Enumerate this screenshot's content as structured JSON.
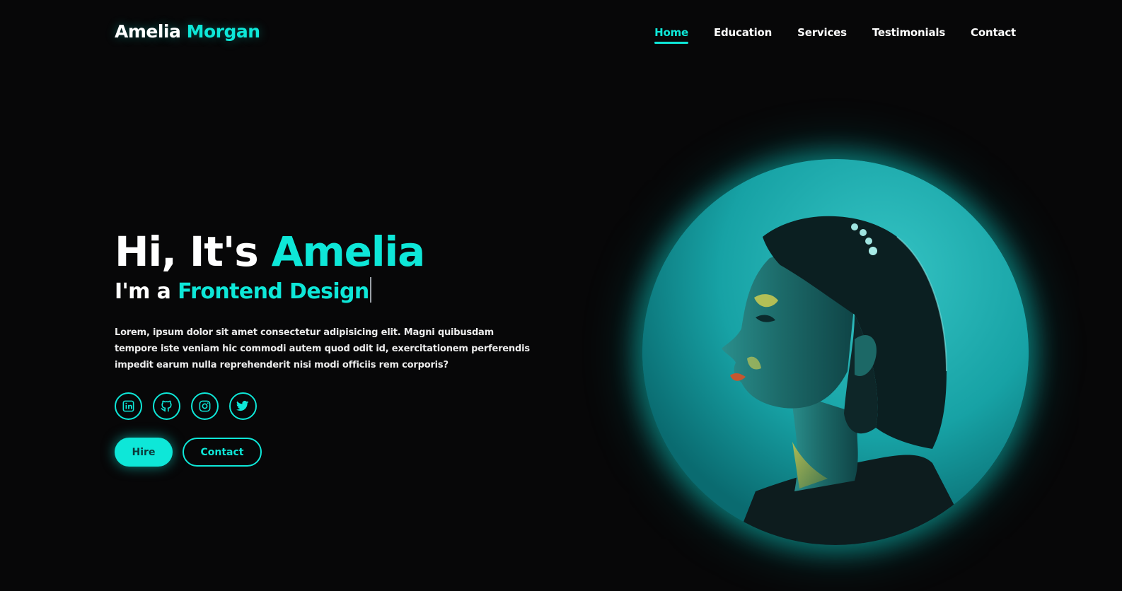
{
  "brand": {
    "first": "Amelia",
    "last": "Morgan"
  },
  "nav": {
    "items": [
      {
        "label": "Home",
        "active": true
      },
      {
        "label": "Education",
        "active": false
      },
      {
        "label": "Services",
        "active": false
      },
      {
        "label": "Testimonials",
        "active": false
      },
      {
        "label": "Contact",
        "active": false
      }
    ]
  },
  "hero": {
    "greeting": "Hi, It's",
    "name": "Amelia",
    "role_prefix": "I'm a",
    "role": "Frontend Design",
    "description": "Lorem, ipsum dolor sit amet consectetur adipisicing elit. Magni quibusdam tempore iste veniam hic commodi autem quod odit id, exercitationem perferendis impedit earum nulla reprehenderit nisi modi officiis rem corporis?"
  },
  "socials": [
    {
      "icon": "linkedin-icon"
    },
    {
      "icon": "github-icon"
    },
    {
      "icon": "instagram-icon"
    },
    {
      "icon": "twitter-icon"
    }
  ],
  "buttons": {
    "hire": "Hire",
    "contact": "Contact"
  },
  "colors": {
    "accent": "#0ee7d8",
    "background": "#070708",
    "text": "#ffffff"
  }
}
